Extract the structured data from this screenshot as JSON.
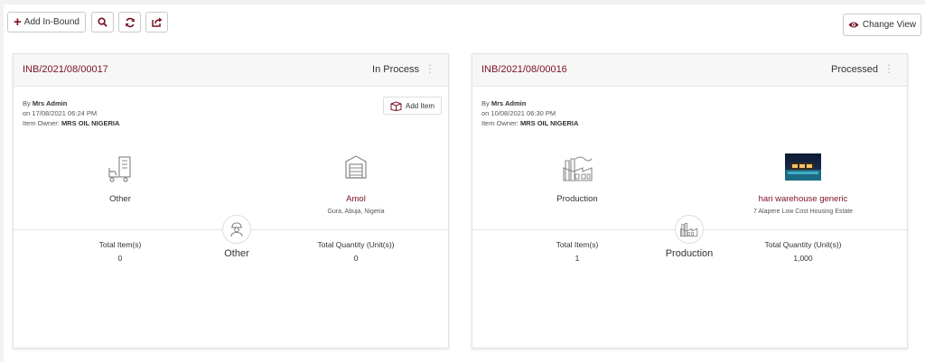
{
  "toolbar": {
    "add_inbound_label": "Add In-Bound",
    "change_view_label": "Change View"
  },
  "cards": [
    {
      "ref": "INB/2021/08/00017",
      "status": "In Process",
      "by_prefix": "By",
      "by_name": "Mrs Admin",
      "date": "on 17/08/2021 06:24 PM",
      "owner_prefix": "Item Owner:",
      "owner": "MRS OIL NIGERIA",
      "add_item_label": "Add Item",
      "source": {
        "label": "Other"
      },
      "destination": {
        "name": "Amol",
        "address": "Gura, Abuja, Nigeria"
      },
      "center_label": "Other",
      "total_items_label": "Total Item(s)",
      "total_items": "0",
      "total_qty_label": "Total Quantity (Unit(s))",
      "total_qty": "0"
    },
    {
      "ref": "INB/2021/08/00016",
      "status": "Processed",
      "by_prefix": "By",
      "by_name": "Mrs Admin",
      "date": "on 10/08/2021 06:30 PM",
      "owner_prefix": "Item Owner:",
      "owner": "MRS OIL NIGERIA",
      "source": {
        "label": "Production"
      },
      "destination": {
        "name": "hari warehouse generic",
        "address": "7 Alapere Low Cost Housing Estate"
      },
      "center_label": "Production",
      "total_items_label": "Total Item(s)",
      "total_items": "1",
      "total_qty_label": "Total Quantity (Unit(s))",
      "total_qty": "1,000"
    }
  ],
  "colors": {
    "accent": "#7b1123"
  }
}
